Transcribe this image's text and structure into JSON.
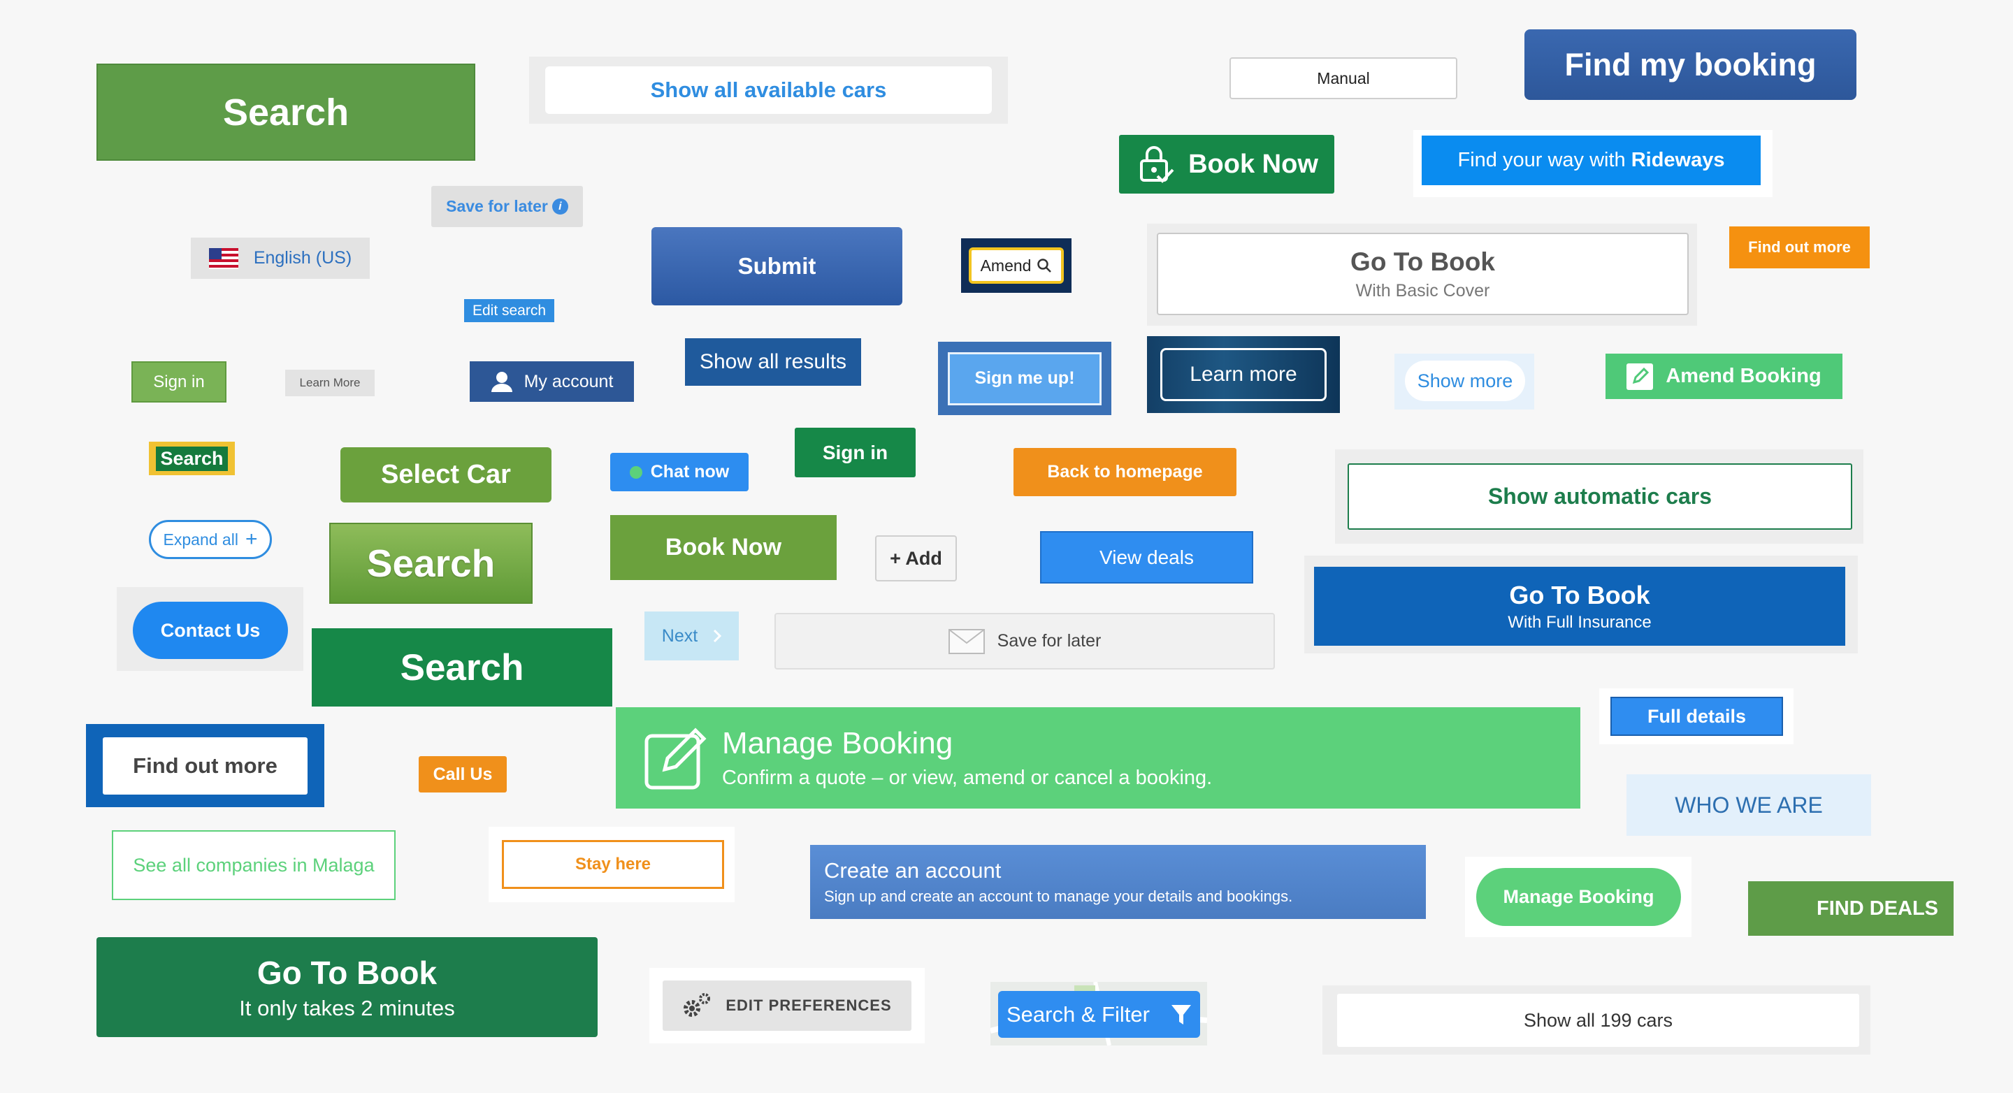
{
  "colors": {
    "background": "#f7f7f7",
    "green": "#5e9c48",
    "dark_green": "#1d7d4c",
    "bright_green": "#5cd17b",
    "blue": "#2f8df0",
    "navy": "#2d579a",
    "orange": "#f0901b"
  },
  "buttons": {
    "search_green": "Search",
    "show_all_available_cars": "Show all available cars",
    "manual": "Manual",
    "find_my_booking": "Find my booking",
    "book_now_dark": "Book Now",
    "find_your_way_prefix": "Find your way with ",
    "find_your_way_brand": "Rideways",
    "save_for_later_small": "Save for later",
    "english_us": "English (US)",
    "submit": "Submit",
    "amend": "Amend",
    "go_to_book_basic_title": "Go To Book",
    "go_to_book_basic_sub": "With Basic Cover",
    "find_out_more_orange": "Find out more",
    "edit_search": "Edit search",
    "sign_in_green": "Sign in",
    "learn_more_small": "Learn More",
    "my_account": "My account",
    "show_all_results": "Show all results",
    "sign_me_up": "Sign me up!",
    "learn_more_dark": "Learn more",
    "show_more": "Show more",
    "amend_booking": "Amend Booking",
    "search_yellow": "Search",
    "select_car": "Select Car",
    "chat_now": "Chat now",
    "sign_in_dark_green": "Sign in",
    "back_to_homepage": "Back to homepage",
    "show_automatic_cars": "Show automatic cars",
    "expand_all": "Expand all",
    "search_gradient": "Search",
    "book_now_olive": "Book Now",
    "add": "+ Add",
    "view_deals": "View deals",
    "go_to_book_full_title": "Go To Book",
    "go_to_book_full_sub": "With Full Insurance",
    "contact_us": "Contact Us",
    "search_dark_green": "Search",
    "next": "Next",
    "save_for_later_wide": "Save for later",
    "full_details": "Full details",
    "find_out_more_boxed": "Find out more",
    "call_us": "Call Us",
    "manage_booking_title": "Manage Booking",
    "manage_booking_sub": "Confirm a quote – or view, amend or cancel a booking.",
    "who_we_are": "WHO WE ARE",
    "see_all_companies": "See all companies in Malaga",
    "stay_here": "Stay here",
    "create_account_title": "Create an account",
    "create_account_sub": "Sign up and create an account to manage your details and bookings.",
    "manage_booking_pill": "Manage Booking",
    "find_deals": "FIND DEALS",
    "go_to_book_2min_title": "Go To Book",
    "go_to_book_2min_sub": "It only takes 2 minutes",
    "edit_preferences": "EDIT PREFERENCES",
    "search_filter": "Search & Filter",
    "show_all_199_cars": "Show all 199 cars"
  }
}
